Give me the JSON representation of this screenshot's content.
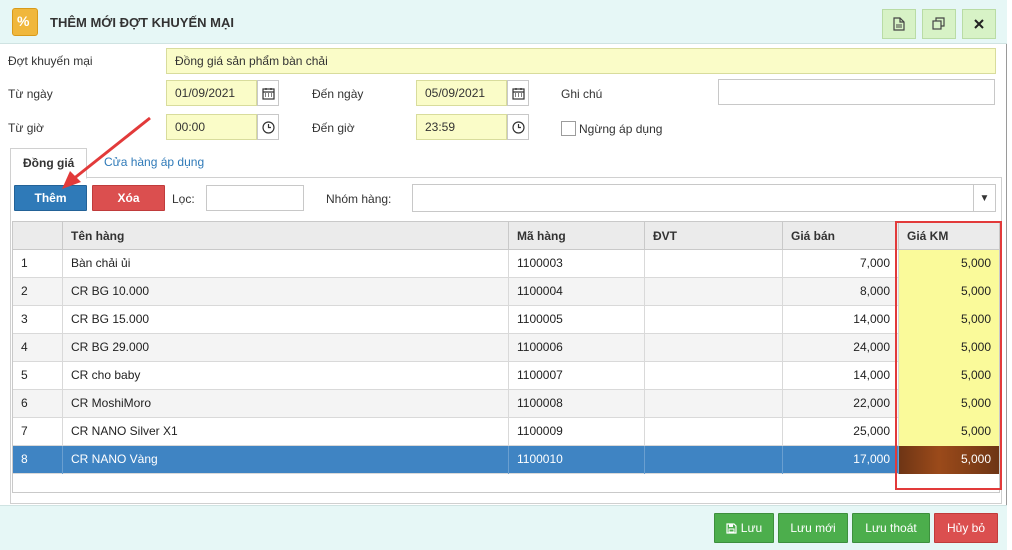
{
  "window": {
    "title": "THÊM MỚI ĐỢT KHUYẾN MẠI",
    "logo_glyph": "%"
  },
  "form": {
    "campaign_label": "Đợt khuyến mại",
    "campaign_value": "Đồng giá sản phẩm bàn chải",
    "from_date_label": "Từ ngày",
    "from_date_value": "01/09/2021",
    "to_date_label": "Đến ngày",
    "to_date_value": "05/09/2021",
    "note_label": "Ghi chú",
    "note_value": "",
    "from_time_label": "Từ giờ",
    "from_time_value": "00:00",
    "to_time_label": "Đến giờ",
    "to_time_value": "23:59",
    "stop_apply_label": "Ngừng áp dụng"
  },
  "tabs": [
    {
      "label": "Đồng giá"
    },
    {
      "label": "Cửa hàng áp dụng"
    }
  ],
  "toolbar": {
    "add_label": "Thêm",
    "delete_label": "Xóa",
    "filter_label": "Lọc:",
    "filter_value": "",
    "group_label": "Nhóm hàng:",
    "group_value": ""
  },
  "table": {
    "columns": [
      "",
      "Tên hàng",
      "Mã hàng",
      "ĐVT",
      "Giá bán",
      "Giá KM"
    ],
    "rows": [
      {
        "no": "1",
        "name": "Bàn chải ủi",
        "code": "1100003",
        "unit": "",
        "price": "7,000",
        "promo": "5,000"
      },
      {
        "no": "2",
        "name": "CR BG 10.000",
        "code": "1100004",
        "unit": "",
        "price": "8,000",
        "promo": "5,000"
      },
      {
        "no": "3",
        "name": "CR BG 15.000",
        "code": "1100005",
        "unit": "",
        "price": "14,000",
        "promo": "5,000"
      },
      {
        "no": "4",
        "name": "CR BG 29.000",
        "code": "1100006",
        "unit": "",
        "price": "24,000",
        "promo": "5,000"
      },
      {
        "no": "5",
        "name": "CR cho baby",
        "code": "1100007",
        "unit": "",
        "price": "14,000",
        "promo": "5,000"
      },
      {
        "no": "6",
        "name": "CR MoshiMoro",
        "code": "1100008",
        "unit": "",
        "price": "22,000",
        "promo": "5,000"
      },
      {
        "no": "7",
        "name": "CR NANO Silver X1",
        "code": "1100009",
        "unit": "",
        "price": "25,000",
        "promo": "5,000"
      },
      {
        "no": "8",
        "name": "CR NANO Vàng",
        "code": "1100010",
        "unit": "",
        "price": "17,000",
        "promo": "5,000"
      }
    ]
  },
  "footer": {
    "save_label": "Lưu",
    "save_new_label": "Lưu mới",
    "save_exit_label": "Lưu thoát",
    "cancel_label": "Hủy bỏ"
  },
  "colors": {
    "accent_blue": "#2f7ab8",
    "danger_red": "#db4f4f",
    "success_green": "#4cae4c",
    "highlight_yellow": "#fafa9a",
    "annotation_red": "#e23a3a"
  }
}
